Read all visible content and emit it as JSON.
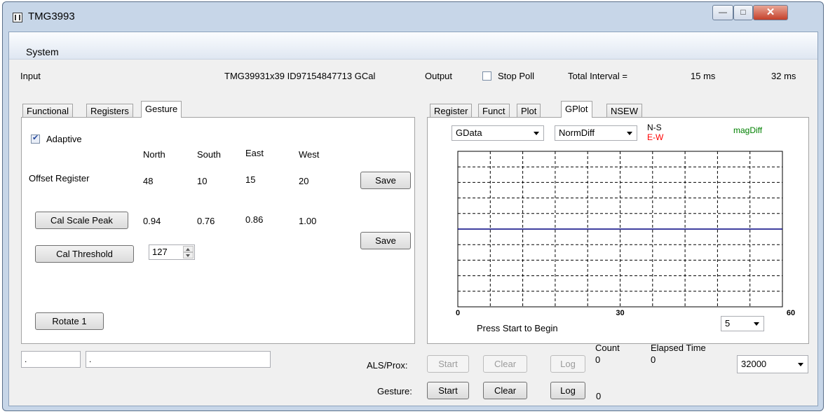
{
  "window": {
    "title": "TMG3993"
  },
  "menu": {
    "system": "System"
  },
  "header": {
    "input_label": "Input",
    "device_info": "TMG39931x39 ID97154847713 GCal",
    "output_label": "Output",
    "stop_poll_label": "Stop Poll",
    "stop_poll_checked": false,
    "total_interval_label": "Total Interval =",
    "interval_1": "15 ms",
    "interval_2": "32 ms"
  },
  "left_tabs": [
    "Functional",
    "Registers",
    "Gesture"
  ],
  "left_active_tab": "Gesture",
  "gesture": {
    "adaptive_label": "Adaptive",
    "adaptive_checked": true,
    "columns": [
      "North",
      "South",
      "East",
      "West"
    ],
    "offset_label": "Offset Register",
    "offset_values": [
      "48",
      "10",
      "15",
      "20"
    ],
    "save_label": "Save",
    "cal_scale_peak_label": "Cal Scale Peak",
    "scale_values": [
      "0.94",
      "0.76",
      "0.86",
      "1.00"
    ],
    "save2_label": "Save",
    "cal_threshold_label": "Cal Threshold",
    "threshold_value": "127",
    "rotate_label": "Rotate 1"
  },
  "right_tabs": [
    "Register",
    "Funct",
    "Plot",
    "GPlot",
    "NSEW"
  ],
  "right_active_tab": "GPlot",
  "gplot": {
    "source_select": "GData",
    "mode_select": "NormDiff",
    "legend_ns": "N-S",
    "legend_ew": "E-W",
    "legend_mag": "magDiff",
    "x_ticks": [
      "0",
      "30",
      "60"
    ],
    "status": "Press Start to Begin",
    "window_select": "5",
    "colors": {
      "ns": "#000000",
      "ew": "#ff0000",
      "mag": "#008000",
      "trace": "#000080"
    }
  },
  "chart_data": {
    "type": "line",
    "xlim": [
      0,
      60
    ],
    "x_ticks": [
      0,
      30,
      60
    ],
    "series": [
      {
        "name": "N-S",
        "x": [
          0,
          60
        ],
        "values": [
          0,
          0
        ]
      }
    ],
    "grid": true
  },
  "bottom": {
    "field1": ".",
    "field2": ".",
    "als_label": "ALS/Prox:",
    "gesture_label": "Gesture:",
    "start_label": "Start",
    "clear_label": "Clear",
    "log_label": "Log",
    "count_label": "Count",
    "count_value": "0",
    "elapsed_label": "Elapsed Time",
    "elapsed_value": "0",
    "gesture_count": "0",
    "rate_select": "32000"
  }
}
